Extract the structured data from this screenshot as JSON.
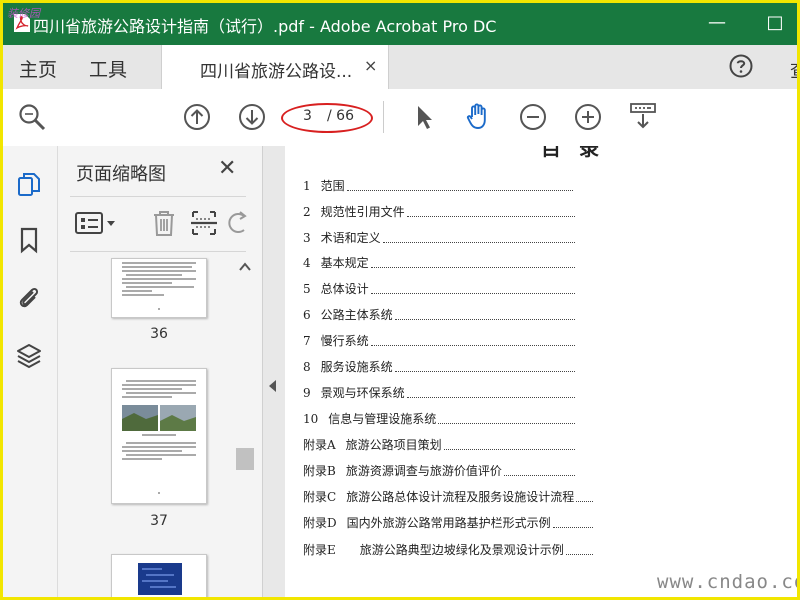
{
  "window": {
    "title": "四川省旅游公路设计指南（试行）.pdf - Adobe Acrobat Pro DC",
    "minimize_glyph": "—",
    "maximize_glyph": "□",
    "brand_color": "#18793f"
  },
  "tabs": {
    "home_label": "主页",
    "tools_label": "工具",
    "document_label": "四川省旅游公路设...",
    "close_glyph": "×",
    "overflow_label": "查"
  },
  "toolbar": {
    "current_page": "3",
    "total_pages": "/ 66",
    "icons": [
      "search-icon",
      "previous-page-icon",
      "next-page-icon",
      "select-pointer-icon",
      "hand-tool-icon",
      "zoom-out-icon",
      "zoom-in-icon",
      "keyboard-scroll-icon"
    ]
  },
  "rail": {
    "icons": [
      "page-thumbnails-icon",
      "bookmarks-icon",
      "attachments-icon",
      "layers-icon"
    ]
  },
  "thumbnails_panel": {
    "title": "页面缩略图",
    "close_glyph": "✕",
    "pages": [
      {
        "label": "36"
      },
      {
        "label": "37"
      }
    ]
  },
  "document": {
    "heading": "目录",
    "toc": [
      {
        "num": "1",
        "title": "范围"
      },
      {
        "num": "2",
        "title": "规范性引用文件"
      },
      {
        "num": "3",
        "title": "术语和定义"
      },
      {
        "num": "4",
        "title": "基本规定"
      },
      {
        "num": "5",
        "title": "总体设计"
      },
      {
        "num": "6",
        "title": "公路主体系统"
      },
      {
        "num": "7",
        "title": "慢行系统"
      },
      {
        "num": "8",
        "title": "服务设施系统"
      },
      {
        "num": "9",
        "title": "景观与环保系统"
      },
      {
        "num": "10",
        "title": "信息与管理设施系统"
      },
      {
        "num": "附录A",
        "title": "旅游公路项目策划"
      },
      {
        "num": "附录B",
        "title": "旅游资源调查与旅游价值评价"
      },
      {
        "num": "附录C",
        "title": "旅游公路总体设计流程及服务设施设计流程"
      },
      {
        "num": "附录D",
        "title": "国内外旅游公路常用路基护栏形式示例"
      },
      {
        "num": "附录E",
        "title": "旅游公路典型边坡绿化及景观设计示例"
      }
    ]
  },
  "overlay": {
    "watermark": "www.cndao.com",
    "corner_mark": "装修园"
  }
}
